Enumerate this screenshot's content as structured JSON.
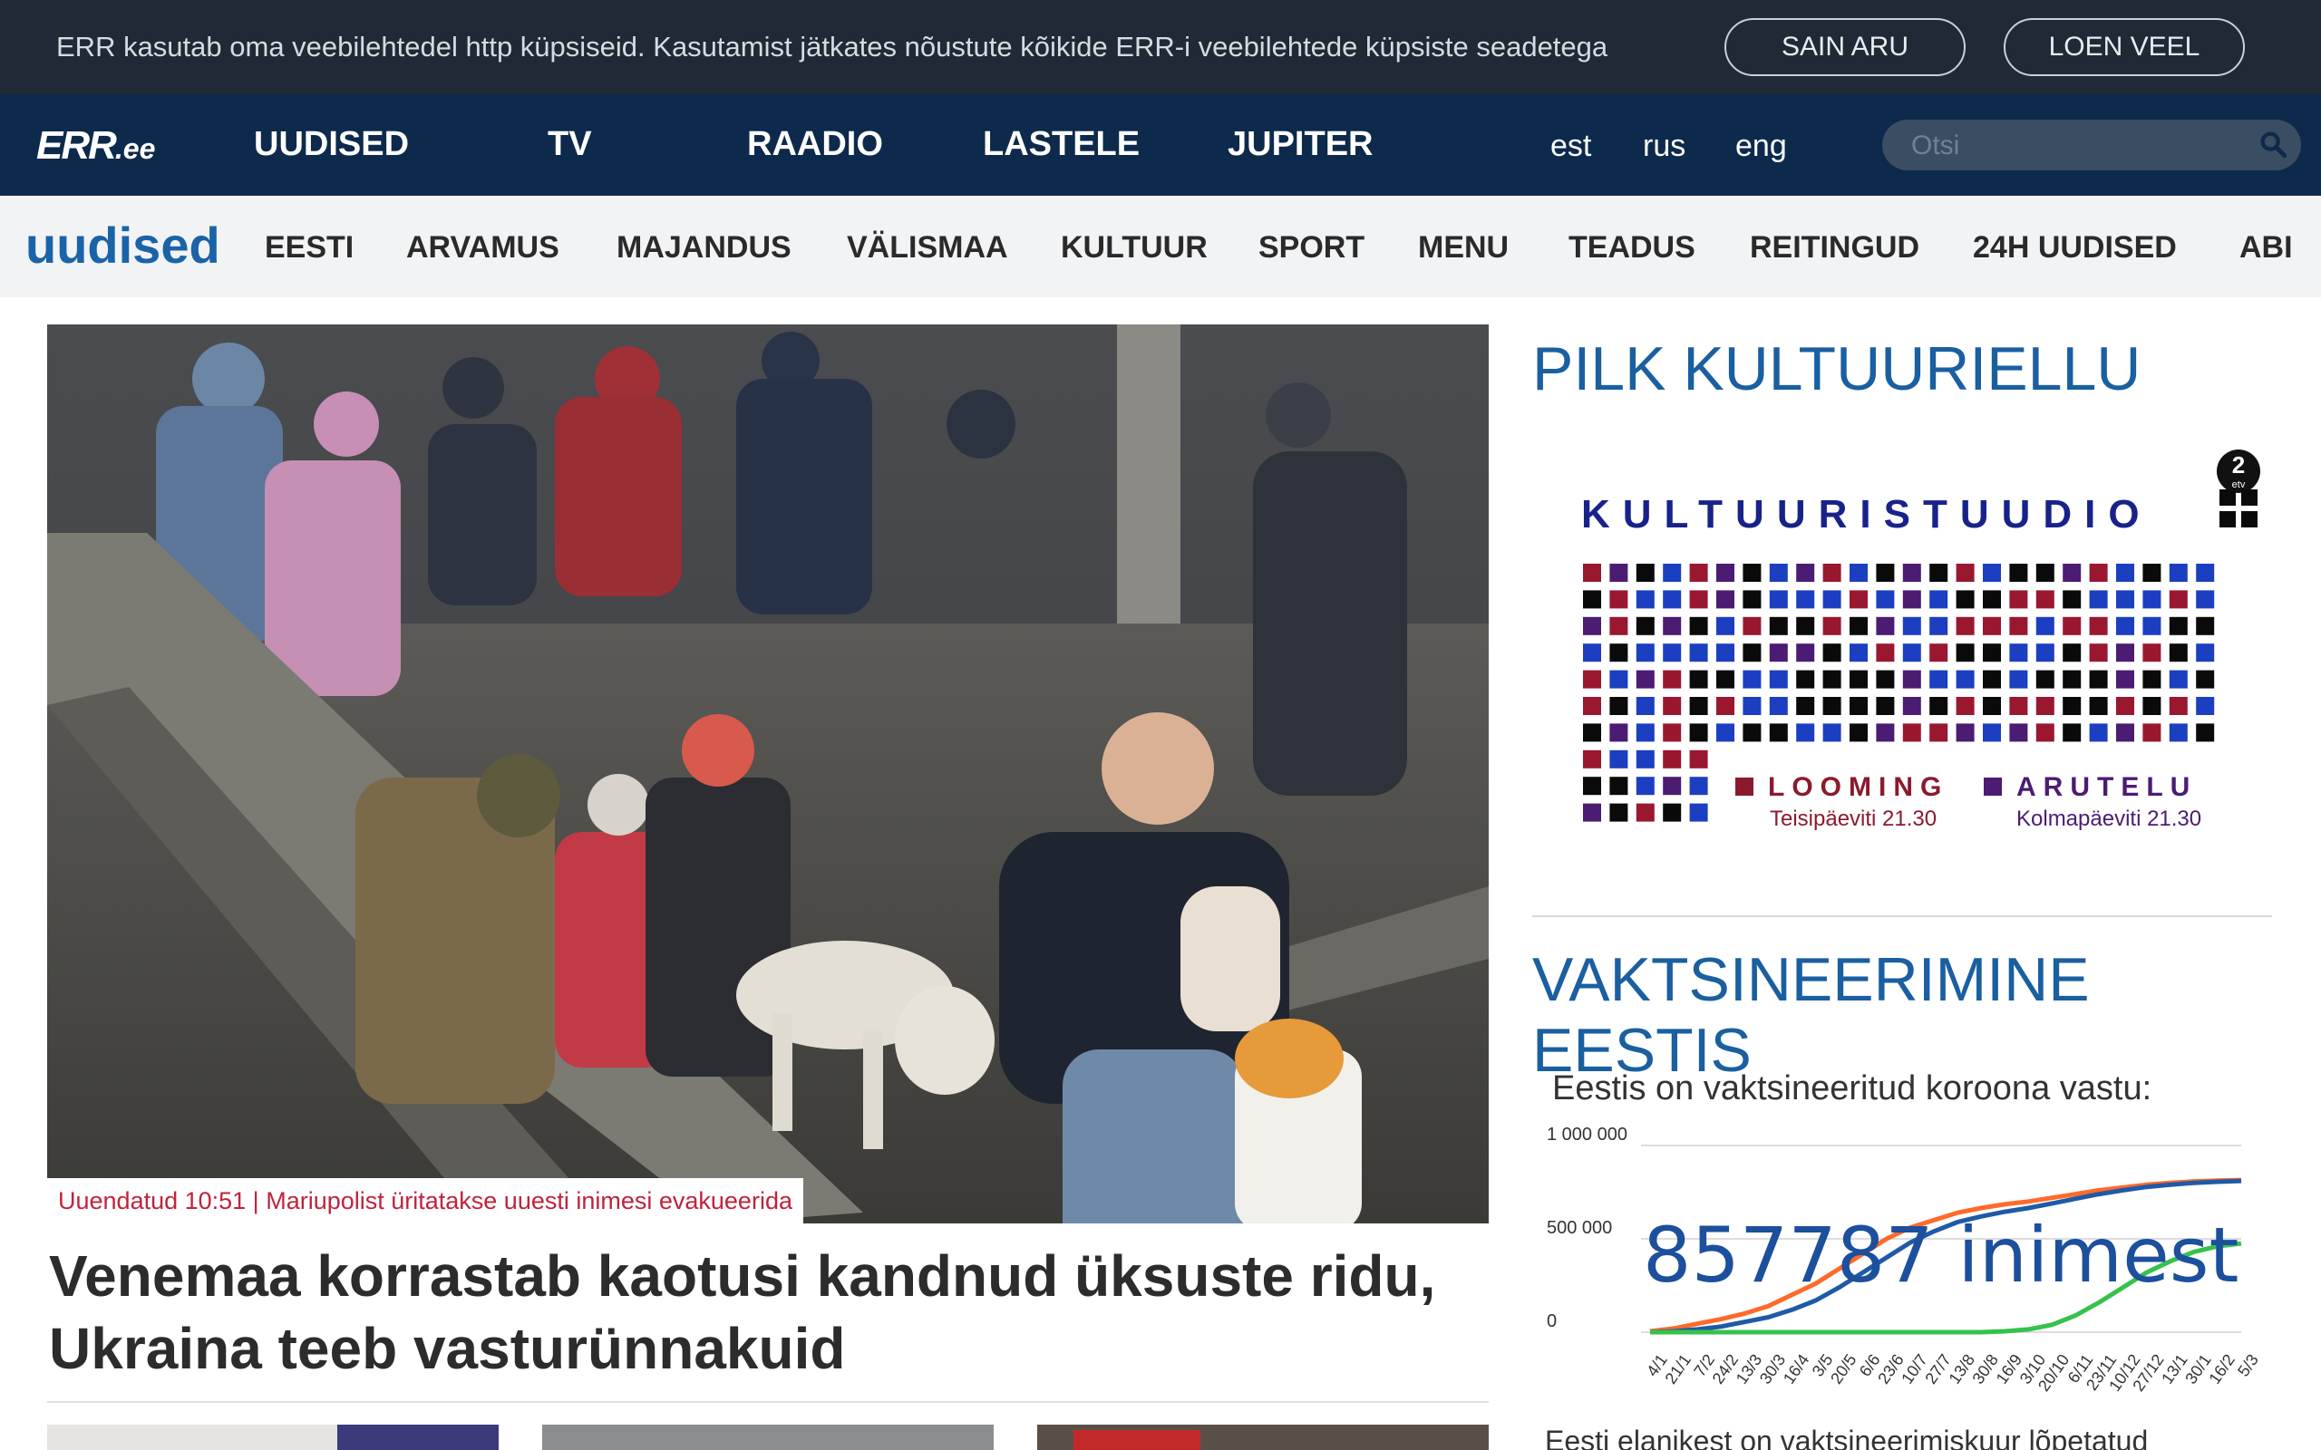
{
  "cookie": {
    "text": "ERR kasutab oma veebilehtedel http küpsiseid. Kasutamist jätkates nõustute kõikide ERR-i veebilehtede küpsiste seadetega",
    "accept_label": "SAIN ARU",
    "more_label": "LOEN VEEL"
  },
  "topnav": {
    "logo": "ERR",
    "logo_suffix": ".ee",
    "items": [
      "UUDISED",
      "TV",
      "RAADIO",
      "LASTELE",
      "JUPITER"
    ],
    "languages": [
      "est",
      "rus",
      "eng"
    ],
    "search_placeholder": "Otsi",
    "bg_color": "#0d2a4c"
  },
  "section_nav": {
    "title": "uudised",
    "items": [
      "EESTI",
      "ARVAMUS",
      "MAJANDUS",
      "VÄLISMAA",
      "KULTUUR",
      "SPORT",
      "MENU",
      "TEADUS",
      "REITINGUD",
      "24H UUDISED",
      "ABI"
    ]
  },
  "main_article": {
    "tag": "Uuendatud 10:51 | Mariupolist üritatakse uuesti inimesi evakueerida",
    "headline": "Venemaa korrastab kaotusi kandnud üksuste ridu, Ukraina teeb vasturünnakuid"
  },
  "sidebar": {
    "promo_heading": "PILK KULTUURIELLU",
    "promo": {
      "channel": "2",
      "channel_sub": "etv",
      "title": "KULTUURISTUUDIO",
      "show1": "LOOMING",
      "show1_time": "Teisipäeviti 21.30",
      "show2": "ARUTELU",
      "show2_time": "Kolmapäeviti 21.30"
    },
    "vaccination_heading": "VAKTSINEERIMINE EESTIS",
    "vaccination_subtitle": "Eestis on vaktsineeritud koroona vastu:",
    "vaccination_count": "857787 inimest",
    "vaccination_footer": "Eesti elanikest on vaktsineerimiskuur lõpetatud"
  },
  "chart_data": {
    "type": "line",
    "title": "",
    "ylim": [
      0,
      1000000
    ],
    "y_tick_labels": [
      "1 000 000",
      "500 000",
      "0"
    ],
    "x": [
      "4/1",
      "21/1",
      "7/2",
      "24/2",
      "13/3",
      "30/3",
      "16/4",
      "3/5",
      "20/5",
      "6/6",
      "23/6",
      "10/7",
      "27/7",
      "13/8",
      "30/8",
      "16/9",
      "3/10",
      "20/10",
      "6/11",
      "23/11",
      "10/12",
      "27/12",
      "13/1",
      "30/1",
      "16/2",
      "5/3"
    ],
    "series": [
      {
        "color": "#ff6a2a",
        "values": [
          5000,
          20000,
          45000,
          70000,
          100000,
          140000,
          200000,
          260000,
          340000,
          420000,
          500000,
          560000,
          600000,
          640000,
          665000,
          685000,
          700000,
          720000,
          740000,
          760000,
          775000,
          790000,
          800000,
          808000,
          812000,
          815000
        ]
      },
      {
        "color": "#1f5aa6",
        "values": [
          0,
          5000,
          15000,
          30000,
          55000,
          80000,
          120000,
          170000,
          240000,
          320000,
          400000,
          480000,
          540000,
          590000,
          620000,
          645000,
          665000,
          690000,
          715000,
          740000,
          760000,
          778000,
          790000,
          800000,
          806000,
          810000
        ]
      },
      {
        "color": "#35c24b",
        "values": [
          0,
          0,
          0,
          0,
          0,
          0,
          0,
          0,
          0,
          0,
          0,
          0,
          0,
          0,
          0,
          5000,
          15000,
          40000,
          90000,
          160000,
          240000,
          320000,
          380000,
          430000,
          460000,
          475000
        ]
      }
    ]
  }
}
